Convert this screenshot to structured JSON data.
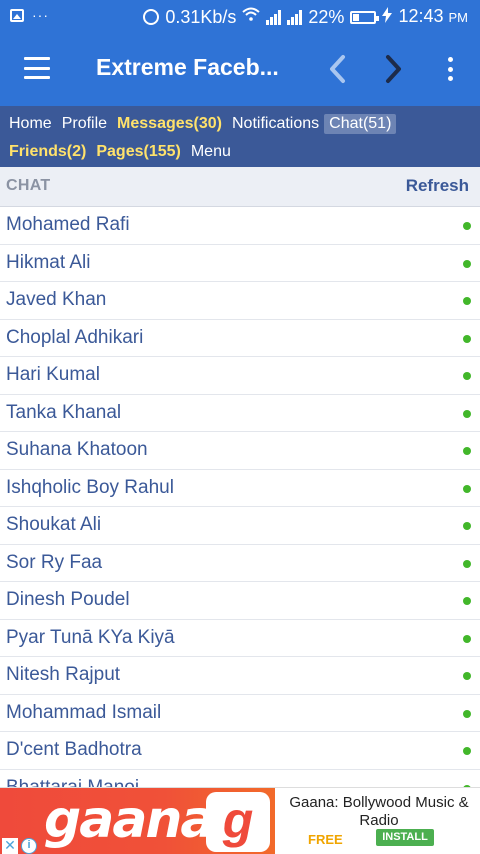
{
  "status_bar": {
    "network_speed": "0.31Kb/s",
    "battery_percent": "22%",
    "time": "12:43",
    "time_suffix": "PM",
    "left_dots": "···"
  },
  "app_bar": {
    "title": "Extreme Faceb..."
  },
  "fb_nav": {
    "row1": [
      {
        "label": "Home",
        "style": "normal"
      },
      {
        "label": "Profile",
        "style": "normal"
      },
      {
        "label": "Messages(30)",
        "style": "highlight"
      },
      {
        "label": "Notifications",
        "style": "normal"
      },
      {
        "label": "Chat(51)",
        "style": "selected"
      }
    ],
    "row2": [
      {
        "label": "Friends(2)",
        "style": "highlight"
      },
      {
        "label": "Pages(155)",
        "style": "highlight"
      },
      {
        "label": "Menu",
        "style": "normal"
      }
    ]
  },
  "chat": {
    "header": "CHAT",
    "refresh_label": "Refresh",
    "contacts": [
      "Mohamed Rafi",
      "Hikmat Ali",
      "Javed Khan",
      "Choplal Adhikari",
      "Hari Kumal",
      "Tanka Khanal",
      "Suhana Khatoon",
      "Ishqholic Boy Rahul",
      "Shoukat Ali",
      "Sor Ry Faa",
      "Dinesh Poudel",
      "Pyar Tunā KYa Kiyā",
      "Nitesh Rajput",
      "Mohammad Ismail",
      "D'cent Badhotra",
      "Bhattarai Manoj"
    ]
  },
  "ad": {
    "logo_text": "gaana",
    "logo_letter": "g",
    "title": "Gaana: Bollywood Music & Radio",
    "price": "FREE",
    "install_label": "INSTALL",
    "close_glyph": "✕",
    "info_glyph": "i"
  },
  "colors": {
    "app_bar": "#2f73d6",
    "fb_nav": "#3b5998",
    "highlight": "#ffe26b",
    "online": "#42b72a"
  }
}
